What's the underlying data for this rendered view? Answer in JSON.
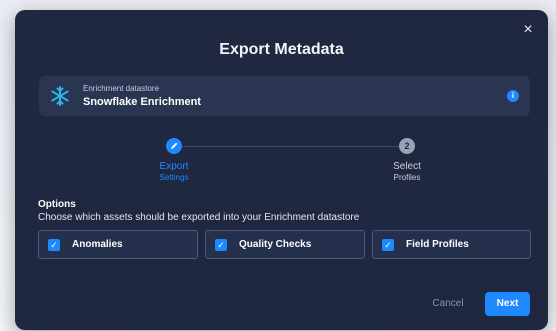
{
  "dialog": {
    "title": "Export Metadata",
    "close_glyph": "×"
  },
  "datastore": {
    "label": "Enrichment datastore",
    "name": "Snowflake Enrichment",
    "icon": "snowflake-icon",
    "info_glyph": "i"
  },
  "steps": [
    {
      "number": "",
      "title": "Export",
      "subtitle": "Settings",
      "status": "active",
      "icon": "pencil-icon"
    },
    {
      "number": "2",
      "title": "Select",
      "subtitle": "Profiles",
      "status": "pending"
    }
  ],
  "options": {
    "heading": "Options",
    "description": "Choose which assets should be exported into your Enrichment datastore",
    "items": [
      {
        "label": "Anomalies",
        "checked": true
      },
      {
        "label": "Quality Checks",
        "checked": true
      },
      {
        "label": "Field Profiles",
        "checked": true
      }
    ],
    "check_glyph": "✓"
  },
  "footer": {
    "cancel_label": "Cancel",
    "next_label": "Next"
  },
  "colors": {
    "accent": "#1e88ff",
    "dialog_bg": "#1f2840",
    "card_bg": "#2a3551"
  }
}
